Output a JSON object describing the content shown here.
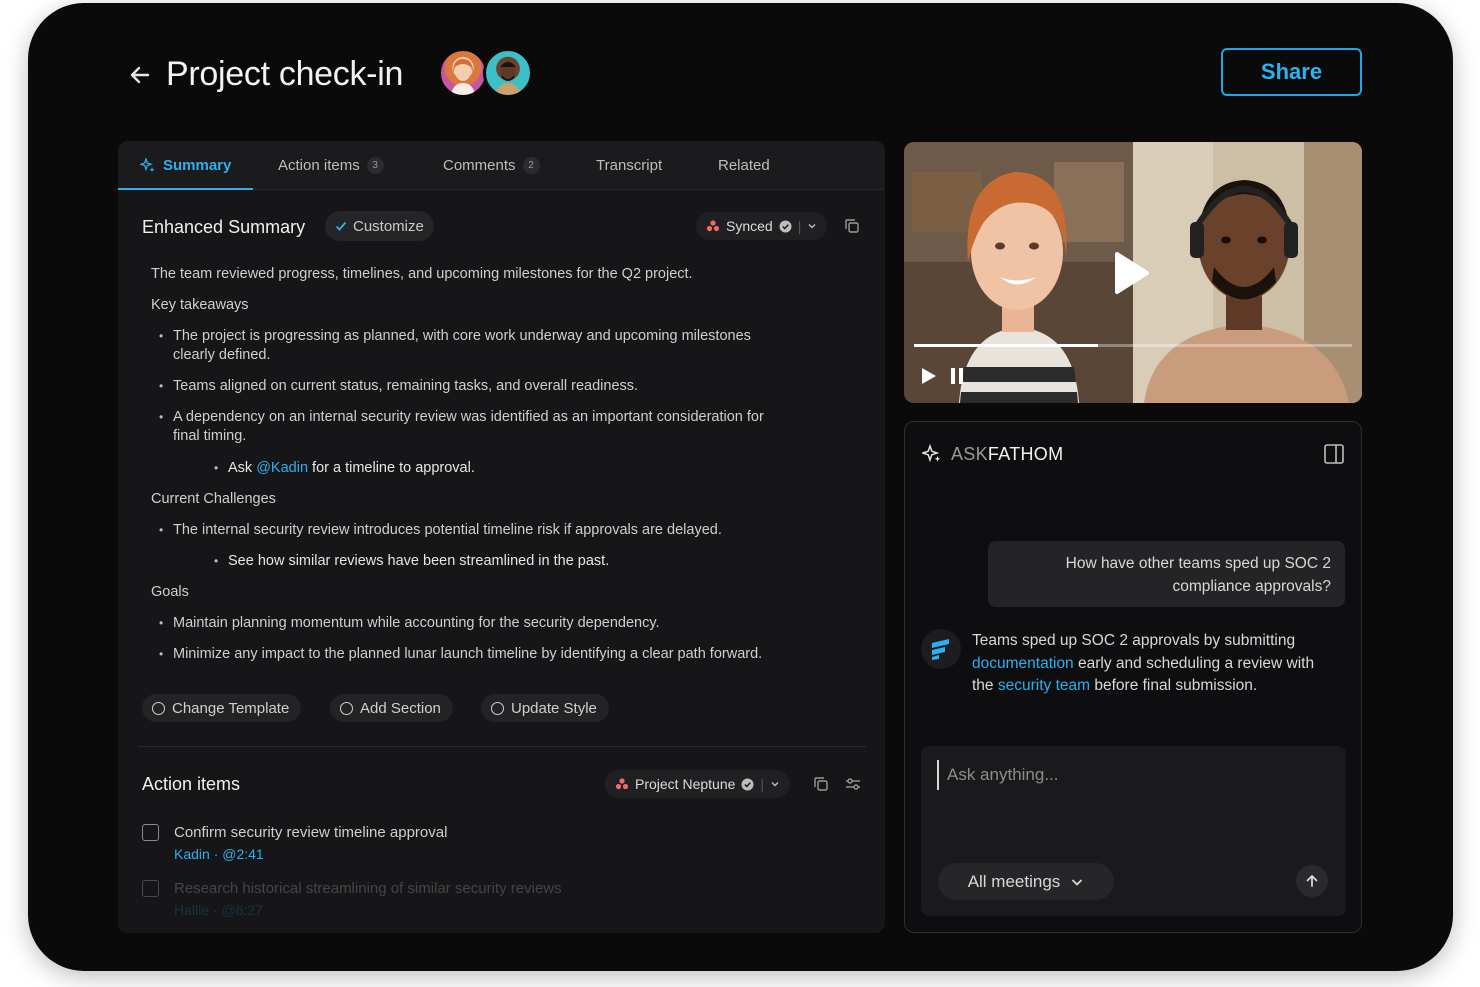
{
  "header": {
    "title": "Project check-in",
    "share_label": "Share"
  },
  "tabs": [
    {
      "label": "Summary"
    },
    {
      "label": "Action items",
      "badge": "3"
    },
    {
      "label": "Comments",
      "badge": "2"
    },
    {
      "label": "Transcript"
    },
    {
      "label": "Related"
    }
  ],
  "summary": {
    "title": "Enhanced Summary",
    "customize_label": "Customize",
    "synced_label": "Synced",
    "intro": "The team reviewed progress, timelines, and upcoming milestones for the Q2 project.",
    "key_takeaways_heading": "Key takeaways",
    "takeaway_1_line1": "The project is progressing as planned, with core work underway and upcoming milestones",
    "takeaway_1_line2": "clearly defined.",
    "takeaway_2": "Teams aligned on current status, remaining tasks, and overall readiness.",
    "takeaway_3_line1": "A dependency on an internal security review was identified as an important consideration for",
    "takeaway_3_line2": "final timing.",
    "sub_ask_prefix": "Ask",
    "sub_ask_mention": "@Kadin",
    "sub_ask_suffix": "for a timeline to approval.",
    "challenges_heading": "Current Challenges",
    "challenge_1": "The internal security review introduces potential timeline risk if approvals are delayed.",
    "challenge_sub": "See how similar reviews have been streamlined in the past.",
    "goals_heading": "Goals",
    "goal_1": "Maintain planning momentum while accounting for the security dependency.",
    "goal_2": "Minimize any impact to the planned lunar launch timeline by identifying a clear path forward.",
    "buttons": {
      "change_template": "Change Template",
      "add_section": "Add Section",
      "update_style": "Update Style"
    }
  },
  "action_items": {
    "title": "Action items",
    "project_label": "Project Neptune",
    "items": [
      {
        "text": "Confirm security review timeline approval",
        "sub": "Kadin · @2:41"
      },
      {
        "text": "Research historical streamlining of similar security reviews",
        "sub": "Hallie · @6:27"
      }
    ]
  },
  "video": {
    "progress": 0.42
  },
  "ask": {
    "title_light": "ASK",
    "title_bold": "FATHOM",
    "user_message_line1": "How have other teams sped up SOC 2",
    "user_message_line2": "compliance approvals?",
    "bot_part1": "Teams sped up SOC 2 approvals by submitting",
    "bot_link1": "documentation",
    "bot_part2": "early and scheduling a review with the",
    "bot_link2": "security team",
    "bot_part3": "before final submission.",
    "input_placeholder": "Ask anything...",
    "meetings_label": "All meetings"
  },
  "colors": {
    "accent": "#2ab0ef",
    "background": "#0a0a0b",
    "panel": "#161618"
  }
}
